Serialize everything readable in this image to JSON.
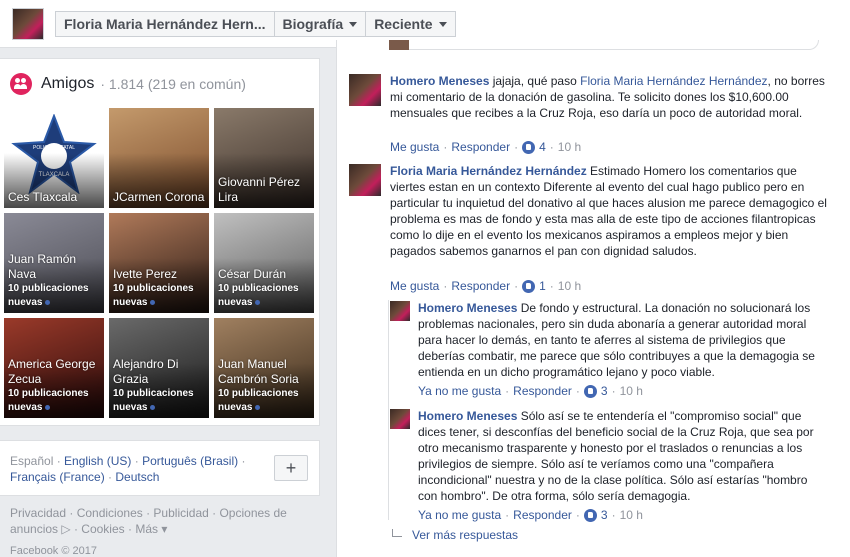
{
  "topbar": {
    "breadcrumbs": [
      {
        "label": "Floria Maria Hernández Hern..."
      },
      {
        "label": "Biografía"
      },
      {
        "label": "Reciente"
      }
    ]
  },
  "friends": {
    "title": "Amigos",
    "count": "· 1.814 (219 en común)",
    "tiles": [
      {
        "name": "Ces Tlaxcala",
        "sub": "",
        "colors": [
          "#1e3d7a",
          "#2b5aa8"
        ],
        "logo_text": "POLICIA ESTATAL",
        "logo_sub": "TLAXCALA"
      },
      {
        "name": "JCarmen Corona",
        "sub": "",
        "colors": [
          "#7a4a2a",
          "#c49a6c"
        ]
      },
      {
        "name": "Giovanni Pérez Lira",
        "sub": "",
        "colors": [
          "#3a2e28",
          "#8a7a6a"
        ]
      },
      {
        "name": "Juan Ramón Nava",
        "sub": "10 publicaciones nuevas",
        "colors": [
          "#4a4a52",
          "#8a8a96"
        ]
      },
      {
        "name": "Ivette Perez",
        "sub": "10 publicaciones nuevas",
        "colors": [
          "#2a1a14",
          "#b07a5a"
        ]
      },
      {
        "name": "César Durán",
        "sub": "10 publicaciones nuevas",
        "colors": [
          "#5a5a5a",
          "#c0c0c0"
        ]
      },
      {
        "name": "America George Zecua",
        "sub": "10 publicaciones nuevas",
        "colors": [
          "#2a0a0a",
          "#9a3a2a"
        ]
      },
      {
        "name": "Alejandro Di Grazia",
        "sub": "10 publicaciones nuevas",
        "colors": [
          "#1a1a1a",
          "#6a6a6a"
        ]
      },
      {
        "name": "Juan Manuel Cambrón Soria",
        "sub": "10 publicaciones nuevas",
        "colors": [
          "#3a2a1a",
          "#a08060"
        ]
      }
    ]
  },
  "languages": {
    "current": "Español",
    "links": [
      "English (US)",
      "Português (Brasil)",
      "Français (France)",
      "Deutsch"
    ],
    "add_label": "+"
  },
  "footer": {
    "links": [
      "Privacidad",
      "Condiciones",
      "Publicidad",
      "Opciones de anuncios",
      "Cookies",
      "Más"
    ],
    "copyright": "Facebook © 2017"
  },
  "comments": [
    {
      "author": "Homero Meneses",
      "text_before": " jajaja, qué paso ",
      "mention": "Floria Maria Hernández Hernández",
      "text_after": ", no borres mi comentario de la donación de gasolina. Te solicito dones los $10,600.00 mensuales que recibes a la Cruz Roja, eso daría un poco de autoridad moral.",
      "like_label": "Me gusta",
      "reply_label": "Responder",
      "likes": "4",
      "time": "10 h"
    },
    {
      "author": "Floria Maria Hernández Hernández",
      "text": " Estimado Homero los comentarios que viertes estan en un contexto Diferente al evento del cual hago publico pero en particular tu inquietud del donativo al que haces alusion me parece demagogico el problema es mas de fondo y esta mas alla de este tipo de acciones filantropicas como lo dije en el evento los mexicanos aspiramos a empleos mejor y bien pagados sabemos ganarnos el pan con dignidad saludos.",
      "like_label": "Me gusta",
      "reply_label": "Responder",
      "likes": "1",
      "time": "10 h"
    },
    {
      "author": "Homero Meneses",
      "text": " De fondo y estructural. La donación no solucionará los problemas nacionales, pero sin duda abonaría a generar autoridad moral para hacer lo demás, en tanto te aferres al sistema de privilegios que deberías combatir, me parece que sólo contribuyes a que la demagogia se entienda en un dicho programático lejano y poco viable.",
      "like_label": "Ya no me gusta",
      "reply_label": "Responder",
      "likes": "3",
      "time": "10 h"
    },
    {
      "author": "Homero Meneses",
      "text": " Sólo así se te entendería el \"compromiso social\" que dices tener, si desconfías del beneficio social de la Cruz Roja, que sea por otro mecanismo trasparente y honesto por el traslados o renuncias a los privilegios de siempre. Sólo así te veríamos como una \"compañera incondicional\" nuestra y no de la clase política. Sólo así estarías \"hombro con hombro\". De otra forma, sólo sería demagogia.",
      "like_label": "Ya no me gusta",
      "reply_label": "Responder",
      "likes": "3",
      "time": "10 h"
    }
  ],
  "more_replies": "Ver más respuestas"
}
